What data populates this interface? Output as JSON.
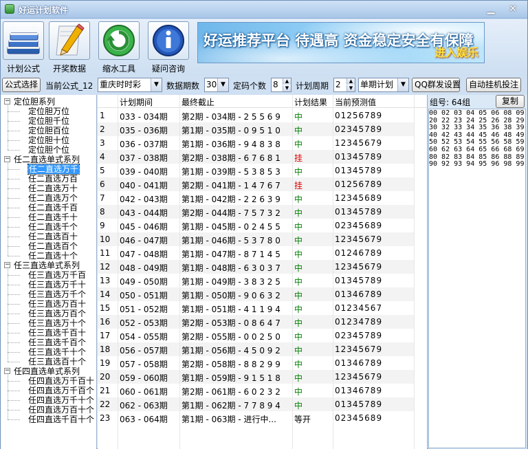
{
  "window": {
    "title": "好运计划软件",
    "minimize": "▁",
    "close": "✕"
  },
  "toolbar": {
    "tools": [
      {
        "label": "计划公式",
        "icon": "books-icon"
      },
      {
        "label": "开奖数据",
        "icon": "pencil-icon"
      },
      {
        "label": "缩水工具",
        "icon": "recycle-icon"
      },
      {
        "label": "疑问咨询",
        "icon": "info-icon"
      }
    ],
    "banner_main": "好运推荐平台 待遇高 资金稳定安全有保障",
    "banner_sub": "进入娱乐"
  },
  "options": {
    "formula_btn": "公式选择",
    "current_formula": "当前公式_12",
    "lottery": "重庆时时彩",
    "periods_label": "数据期数",
    "periods_value": "30",
    "count_label": "定码个数",
    "count_value": "8",
    "cycle_label": "计划周期",
    "cycle_value": "2",
    "plan_type": "单期计划",
    "qq_btn": "QQ群发设置",
    "auto_btn": "自动挂机投注"
  },
  "tree": [
    {
      "label": "定位胆系列",
      "level": 0,
      "expander": "−"
    },
    {
      "label": "定位胆万位",
      "level": 1
    },
    {
      "label": "定位胆千位",
      "level": 1
    },
    {
      "label": "定位胆百位",
      "level": 1
    },
    {
      "label": "定位胆十位",
      "level": 1
    },
    {
      "label": "定位胆个位",
      "level": 1
    },
    {
      "label": "任二直选单式系列",
      "level": 0,
      "expander": "−"
    },
    {
      "label": "任二直选万千",
      "level": 1,
      "selected": true
    },
    {
      "label": "任二直选万百",
      "level": 1
    },
    {
      "label": "任二直选万十",
      "level": 1
    },
    {
      "label": "任二直选万个",
      "level": 1
    },
    {
      "label": "任二直选千百",
      "level": 1
    },
    {
      "label": "任二直选千十",
      "level": 1
    },
    {
      "label": "任二直选千个",
      "level": 1
    },
    {
      "label": "任二直选百十",
      "level": 1
    },
    {
      "label": "任二直选百个",
      "level": 1
    },
    {
      "label": "任二直选十个",
      "level": 1
    },
    {
      "label": "任三直选单式系列",
      "level": 0,
      "expander": "−"
    },
    {
      "label": "任三直选万千百",
      "level": 1
    },
    {
      "label": "任三直选万千十",
      "level": 1
    },
    {
      "label": "任三直选万千个",
      "level": 1
    },
    {
      "label": "任三直选万百十",
      "level": 1
    },
    {
      "label": "任三直选万百个",
      "level": 1
    },
    {
      "label": "任三直选万十个",
      "level": 1
    },
    {
      "label": "任三直选千百十",
      "level": 1
    },
    {
      "label": "任三直选千百个",
      "level": 1
    },
    {
      "label": "任三直选千十个",
      "level": 1
    },
    {
      "label": "任三直选百十个",
      "level": 1
    },
    {
      "label": "任四直选单式系列",
      "level": 0,
      "expander": "−"
    },
    {
      "label": "任四直选万千百十",
      "level": 1
    },
    {
      "label": "任四直选万千百个",
      "level": 1
    },
    {
      "label": "任四直选万千十个",
      "level": 1
    },
    {
      "label": "任四直选万百十个",
      "level": 1
    },
    {
      "label": "任四直选千百十个",
      "level": 1
    }
  ],
  "grid": {
    "headers": {
      "period": "计划期间",
      "last": "最终截止",
      "result": "计划结果",
      "prediction": "当前预测值"
    },
    "rows": [
      {
        "no": "1",
        "period": "033 - 034期",
        "last": "第2期 - 034期 - 2 5 5 6 9",
        "result": "中",
        "status": "hit",
        "pred": "01256789"
      },
      {
        "no": "2",
        "period": "035 - 036期",
        "last": "第1期 - 035期 - 0 9 5 1 0",
        "result": "中",
        "status": "hit",
        "pred": "02345789"
      },
      {
        "no": "3",
        "period": "036 - 037期",
        "last": "第1期 - 036期 - 9 4 8 3 8",
        "result": "中",
        "status": "hit",
        "pred": "12345679"
      },
      {
        "no": "4",
        "period": "037 - 038期",
        "last": "第2期 - 038期 - 6 7 6 8 1",
        "result": "挂",
        "status": "miss",
        "pred": "01345789"
      },
      {
        "no": "5",
        "period": "039 - 040期",
        "last": "第1期 - 039期 - 5 3 8 5 3",
        "result": "中",
        "status": "hit",
        "pred": "01345789"
      },
      {
        "no": "6",
        "period": "040 - 041期",
        "last": "第2期 - 041期 - 1 4 7 6 7",
        "result": "挂",
        "status": "miss",
        "pred": "01256789"
      },
      {
        "no": "7",
        "period": "042 - 043期",
        "last": "第1期 - 042期 - 2 2 6 3 9",
        "result": "中",
        "status": "hit",
        "pred": "12345689"
      },
      {
        "no": "8",
        "period": "043 - 044期",
        "last": "第2期 - 044期 - 7 5 7 3 2",
        "result": "中",
        "status": "hit",
        "pred": "01345789"
      },
      {
        "no": "9",
        "period": "045 - 046期",
        "last": "第1期 - 045期 - 0 2 4 5 5",
        "result": "中",
        "status": "hit",
        "pred": "02345689"
      },
      {
        "no": "10",
        "period": "046 - 047期",
        "last": "第1期 - 046期 - 5 3 7 8 0",
        "result": "中",
        "status": "hit",
        "pred": "12345679"
      },
      {
        "no": "11",
        "period": "047 - 048期",
        "last": "第1期 - 047期 - 8 7 1 4 5",
        "result": "中",
        "status": "hit",
        "pred": "01246789"
      },
      {
        "no": "12",
        "period": "048 - 049期",
        "last": "第1期 - 048期 - 6 3 0 3 7",
        "result": "中",
        "status": "hit",
        "pred": "12345679"
      },
      {
        "no": "13",
        "period": "049 - 050期",
        "last": "第1期 - 049期 - 3 8 3 2 5",
        "result": "中",
        "status": "hit",
        "pred": "01345789"
      },
      {
        "no": "14",
        "period": "050 - 051期",
        "last": "第1期 - 050期 - 9 0 6 3 2",
        "result": "中",
        "status": "hit",
        "pred": "01346789"
      },
      {
        "no": "15",
        "period": "051 - 052期",
        "last": "第1期 - 051期 - 4 1 1 9 4",
        "result": "中",
        "status": "hit",
        "pred": "01234567"
      },
      {
        "no": "16",
        "period": "052 - 053期",
        "last": "第2期 - 053期 - 0 8 6 4 7",
        "result": "中",
        "status": "hit",
        "pred": "01234789"
      },
      {
        "no": "17",
        "period": "054 - 055期",
        "last": "第2期 - 055期 - 0 0 2 5 0",
        "result": "中",
        "status": "hit",
        "pred": "02345789"
      },
      {
        "no": "18",
        "period": "056 - 057期",
        "last": "第1期 - 056期 - 4 5 0 9 2",
        "result": "中",
        "status": "hit",
        "pred": "12345679"
      },
      {
        "no": "19",
        "period": "057 - 058期",
        "last": "第2期 - 058期 - 8 8 2 9 9",
        "result": "中",
        "status": "hit",
        "pred": "01346789"
      },
      {
        "no": "20",
        "period": "059 - 060期",
        "last": "第1期 - 059期 - 9 1 5 1 8",
        "result": "中",
        "status": "hit",
        "pred": "12345679"
      },
      {
        "no": "21",
        "period": "060 - 061期",
        "last": "第2期 - 061期 - 6 0 2 3 2",
        "result": "中",
        "status": "hit",
        "pred": "01346789"
      },
      {
        "no": "22",
        "period": "062 - 063期",
        "last": "第1期 - 062期 - 7 7 8 9 4",
        "result": "中",
        "status": "hit",
        "pred": "01345789"
      },
      {
        "no": "23",
        "period": "063 - 064期",
        "last": "第1期 - 063期 - 进行中...",
        "result": "等开",
        "status": "wait",
        "pred": "02345689"
      }
    ]
  },
  "right": {
    "group_label": "组号: 64组",
    "copy_btn": "复制",
    "numbers": "00 02 03 04 05 06 08 09 20 22 23 24 25 26 28 29 30 32 33 34 35 36 38 39 40 42 43 44 45 46 48 49 50 52 53 54 55 56 58 59 60 62 63 64 65 66 68 69 80 82 83 84 85 86 88 89 90 92 93 94 95 96 98 99"
  }
}
